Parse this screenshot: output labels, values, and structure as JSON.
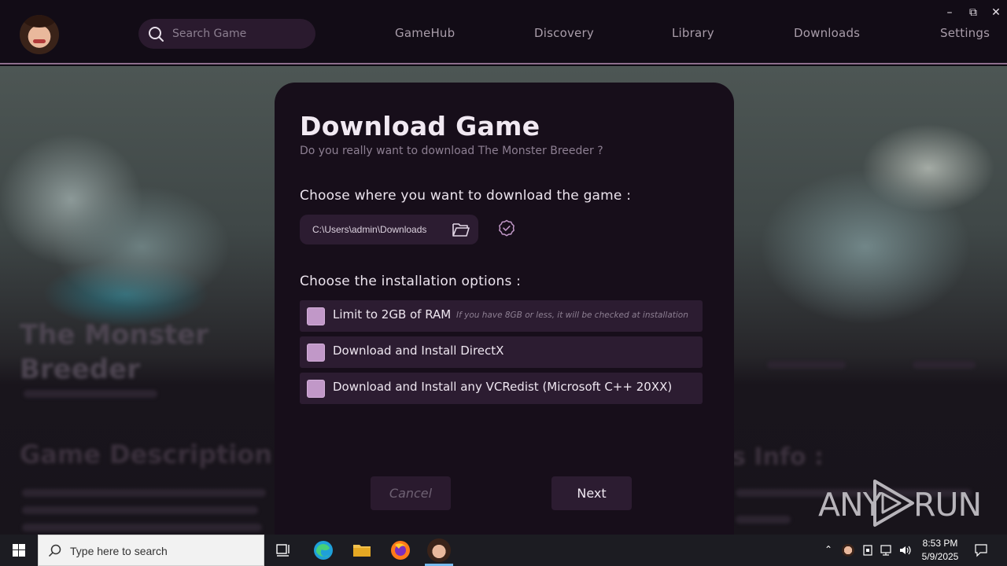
{
  "header": {
    "search_placeholder": "Search Game",
    "nav": [
      "GameHub",
      "Discovery",
      "Library",
      "Downloads",
      "Settings"
    ],
    "window_controls": {
      "minimize": "–",
      "restore": "⧉",
      "close": "✕"
    }
  },
  "background": {
    "game_title_line1": "The Monster",
    "game_title_line2": "Breeder",
    "section_left": "Game Description",
    "section_right": "s Info :"
  },
  "modal": {
    "title": "Download Game",
    "subtitle": "Do you really want to download The Monster Breeder ?",
    "location_label": "Choose where you want to download the game :",
    "path": "C:\\Users\\admin\\Downloads",
    "options_label": "Choose the installation options :",
    "options": [
      {
        "label": "Limit to 2GB of RAM",
        "hint": "If you have 8GB or less, it will be checked at installation",
        "checked": false
      },
      {
        "label": "Download and Install DirectX",
        "checked": false
      },
      {
        "label": "Download and Install any VCRedist (Microsoft C++ 20XX)",
        "checked": false
      }
    ],
    "cancel_label": "Cancel",
    "next_label": "Next"
  },
  "watermark": {
    "left": "ANY",
    "right": "RUN"
  },
  "taskbar": {
    "search_placeholder": "Type here to search",
    "time": "8:53 PM",
    "date": "5/9/2025"
  },
  "colors": {
    "topbar": "#120c16",
    "modal": "#170e1a",
    "field": "#2c1c31",
    "checkbox": "#c198c8",
    "accent_border": "#8e6f8d"
  }
}
